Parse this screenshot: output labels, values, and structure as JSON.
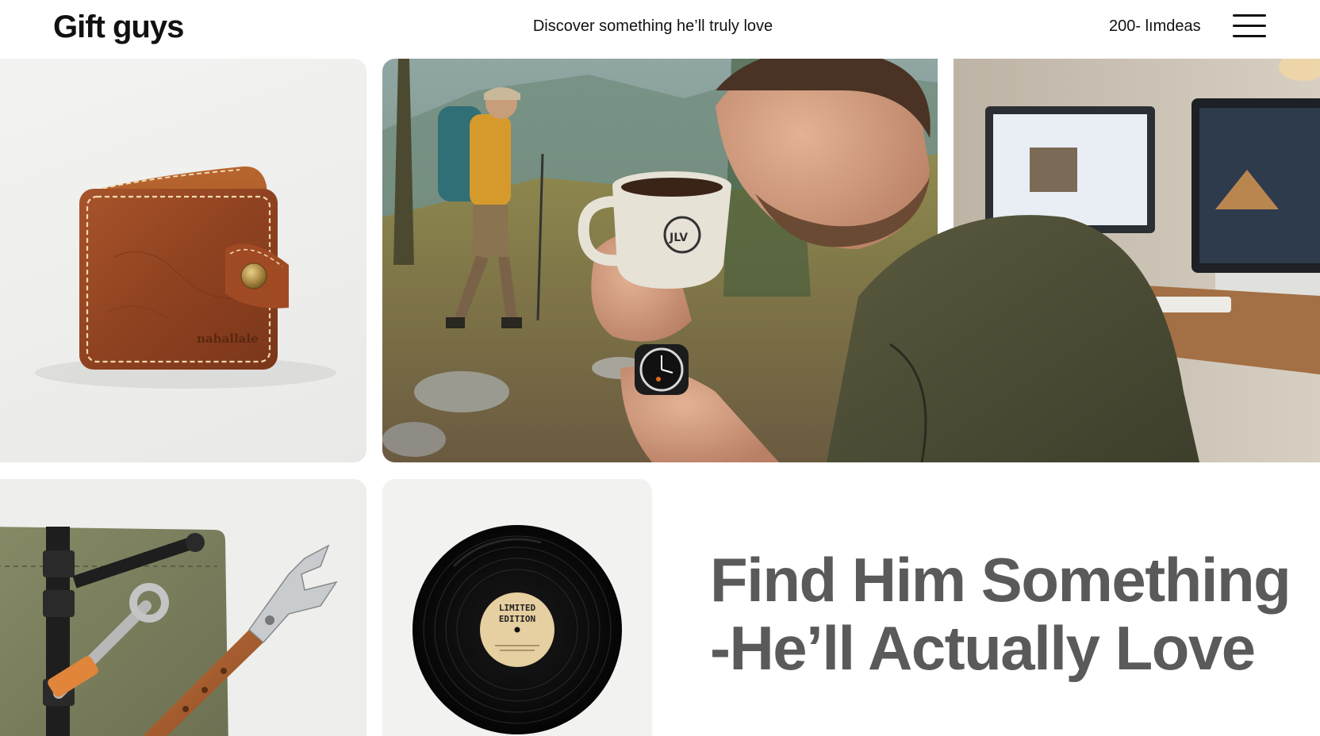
{
  "header": {
    "brand": "Gift guys",
    "tagline": "Discover something he’ll truly love",
    "idea_count": "200- lımdeas",
    "menu_icon": "hamburger-menu-icon"
  },
  "cards": {
    "wallet": {
      "brand_stamp": "nahallale"
    },
    "hero": {
      "mug_logo": "JLV"
    },
    "vinyl": {
      "label_line1": "LIMITED",
      "label_line2": "EDITION"
    }
  },
  "headline": {
    "line1": "Find Him Something",
    "line2": "-He’ll Actually Love"
  },
  "colors": {
    "headline": "#5a5a5a",
    "wallet_leather": "#9b4a25",
    "background": "#ffffff"
  }
}
